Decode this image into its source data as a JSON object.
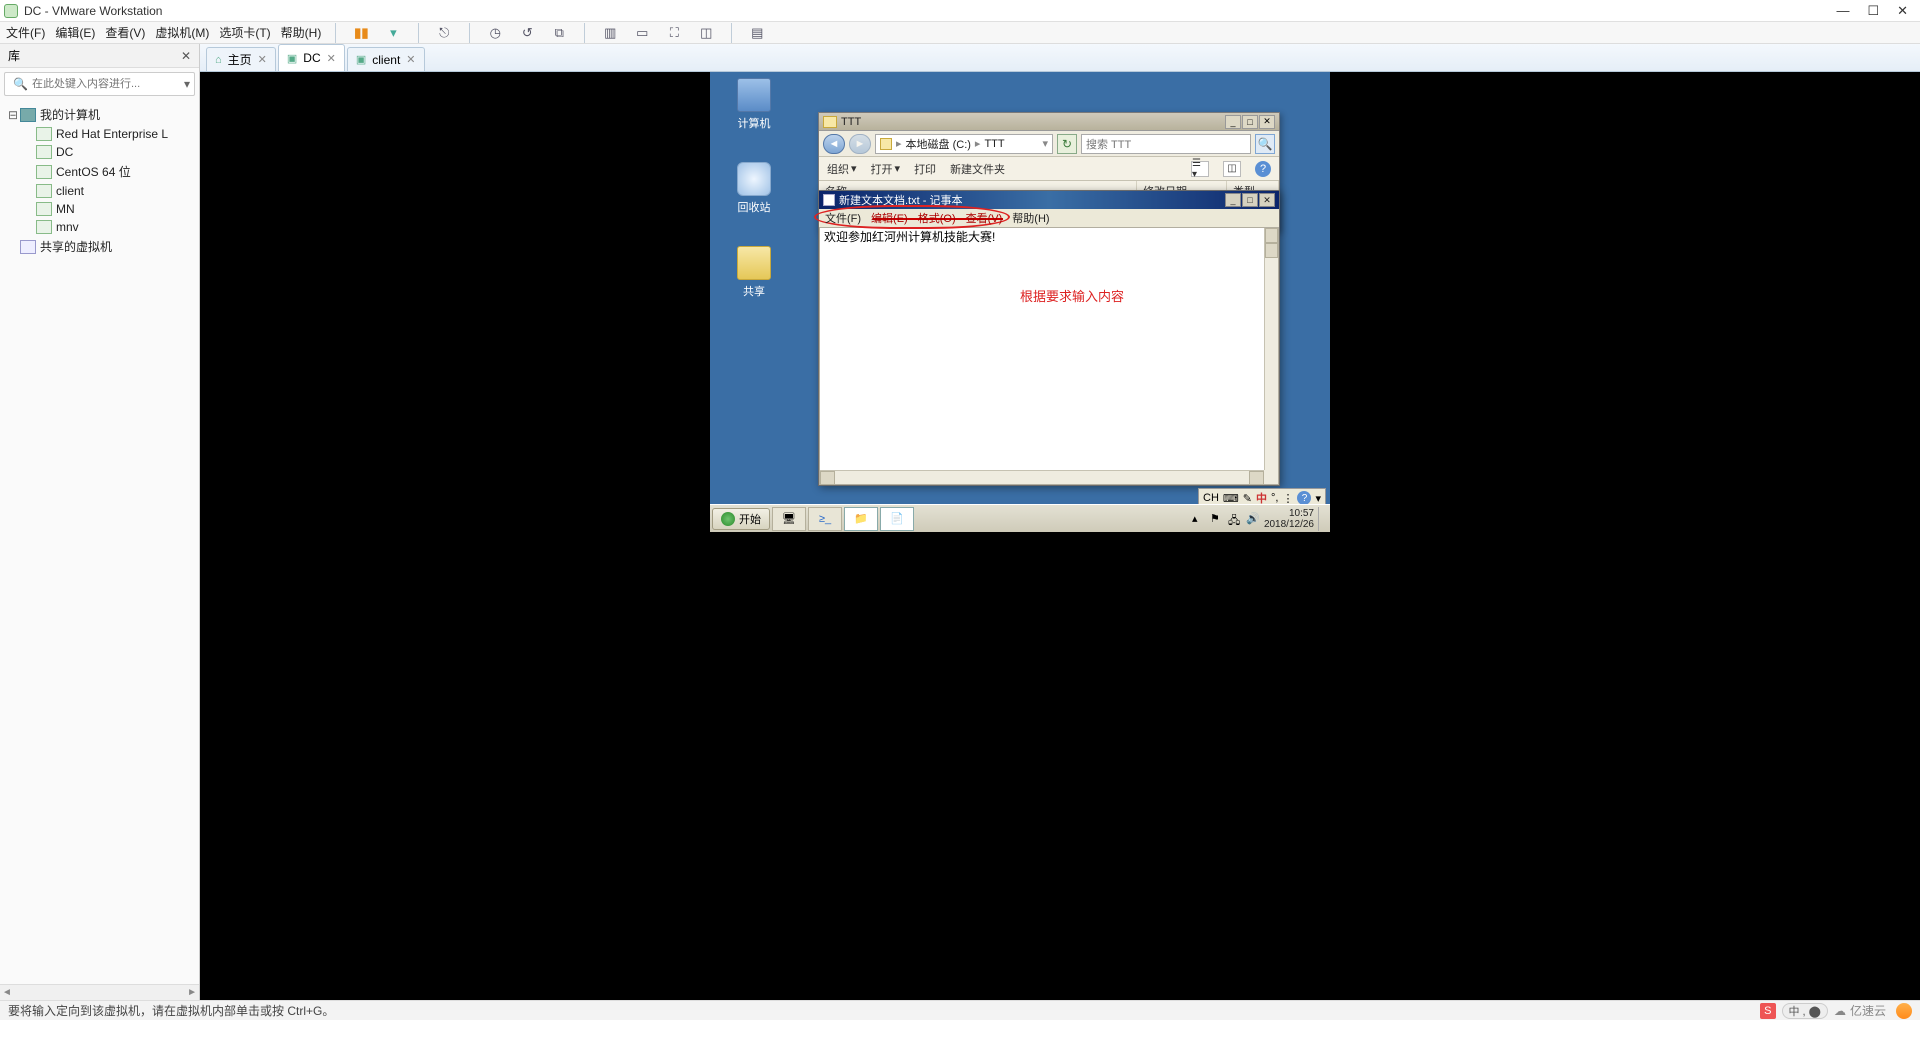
{
  "titlebar": {
    "title": "DC - VMware Workstation"
  },
  "menubar": [
    "文件(F)",
    "编辑(E)",
    "查看(V)",
    "虚拟机(M)",
    "选项卡(T)",
    "帮助(H)"
  ],
  "sidebar": {
    "header": "库",
    "search_placeholder": "在此处键入内容进行...",
    "root": "我的计算机",
    "items": [
      "Red Hat Enterprise L",
      "DC",
      "CentOS 64 位",
      "client",
      "MN",
      "mnv"
    ],
    "shared": "共享的虚拟机"
  },
  "tabs": [
    {
      "icon": "home",
      "label": "主页",
      "closable": true
    },
    {
      "icon": "vm",
      "label": "DC",
      "closable": true,
      "active": true
    },
    {
      "icon": "vm",
      "label": "client",
      "closable": true
    }
  ],
  "guest": {
    "icons": {
      "computer": "计算机",
      "recycle": "回收站",
      "share": "共享"
    },
    "explorer": {
      "title": "TTT",
      "path_parts": [
        "本地磁盘 (C:)",
        "TTT"
      ],
      "search_placeholder": "搜索 TTT",
      "toolbar": {
        "org": "组织",
        "open": "打开",
        "print": "打印",
        "newfolder": "新建文件夹"
      },
      "cols": {
        "name": "名称",
        "date": "修改日期",
        "type": "类型"
      }
    },
    "notepad": {
      "title": "新建文本文档.txt - 记事本",
      "menus": [
        "文件(F)",
        "编辑(E)",
        "格式(O)",
        "查看(V)",
        "帮助(H)"
      ],
      "content": "欢迎参加红河州计算机技能大赛!",
      "annotation": "根据要求输入内容"
    },
    "langbar": {
      "lang": "CH",
      "ime": "中"
    },
    "taskbar": {
      "start": "开始",
      "clock_time": "10:57",
      "clock_date": "2018/12/26"
    }
  },
  "statusbar": {
    "msg": "要将输入定向到该虚拟机，请在虚拟机内部单击或按 Ctrl+G。",
    "badge": "S",
    "pill": "中 , ⬤",
    "brand": "亿速云"
  }
}
